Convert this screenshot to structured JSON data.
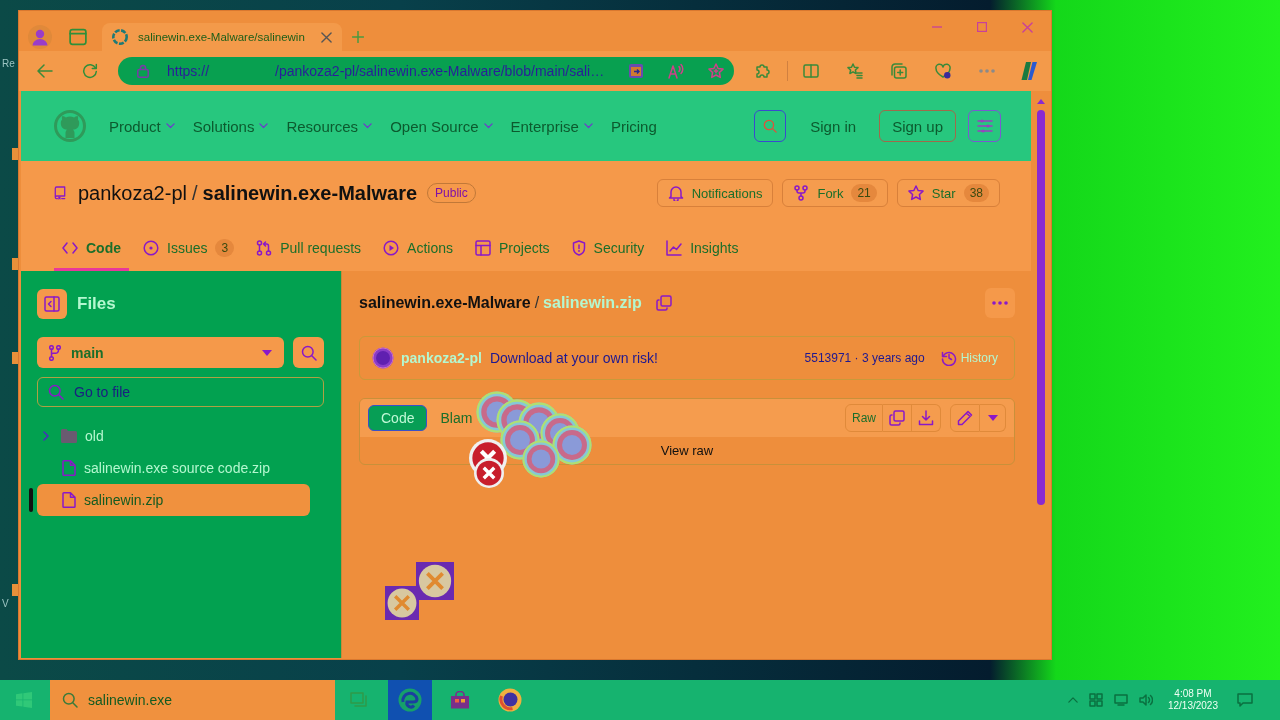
{
  "desktop": {
    "icon_labels": [
      "Re",
      "V"
    ]
  },
  "browser": {
    "tabs": [
      {
        "title": "salinewin.exe-Malware/salinewin",
        "selected": true
      }
    ],
    "address": {
      "scheme": "https://",
      "path": "/pankoza2-pl/salinewin.exe-Malware/blob/main/sali…"
    }
  },
  "site_header": {
    "nav": [
      {
        "label": "Product",
        "dropdown": true
      },
      {
        "label": "Solutions",
        "dropdown": true
      },
      {
        "label": "Resources",
        "dropdown": true
      },
      {
        "label": "Open Source",
        "dropdown": true
      },
      {
        "label": "Enterprise",
        "dropdown": true
      },
      {
        "label": "Pricing",
        "dropdown": false
      }
    ],
    "sign_in": "Sign in",
    "sign_up": "Sign up"
  },
  "repo": {
    "owner": "pankoza2-pl",
    "separator": "/",
    "name": "salinewin.exe-Malware",
    "visibility": "Public",
    "actions": [
      {
        "kind": "notifications",
        "label": "Notifications"
      },
      {
        "kind": "fork",
        "label": "Fork",
        "count": "21"
      },
      {
        "kind": "star",
        "label": "Star",
        "count": "38"
      }
    ],
    "tabs": [
      {
        "kind": "code",
        "label": "Code",
        "selected": true
      },
      {
        "kind": "issues",
        "label": "Issues",
        "count": "3",
        "selected": false
      },
      {
        "kind": "pulls",
        "label": "Pull requests",
        "selected": false
      },
      {
        "kind": "actions",
        "label": "Actions",
        "selected": false
      },
      {
        "kind": "projects",
        "label": "Projects",
        "selected": false
      },
      {
        "kind": "security",
        "label": "Security",
        "selected": false
      },
      {
        "kind": "insights",
        "label": "Insights",
        "selected": false
      }
    ]
  },
  "files_panel": {
    "title": "Files",
    "branch": "main",
    "search_placeholder": "Go to file",
    "tree": [
      {
        "kind": "folder",
        "name": "old",
        "expanded": false,
        "selected": false
      },
      {
        "kind": "file",
        "name": "salinewin.exe source code.zip",
        "selected": false
      },
      {
        "kind": "file",
        "name": "salinewin.zip",
        "selected": true
      }
    ]
  },
  "file": {
    "breadcrumb": {
      "repo": "salinewin.exe-Malware",
      "separator": "/",
      "name": "salinewin.zip"
    },
    "commit": {
      "author": "pankoza2-pl",
      "message": "Download at your own risk!",
      "meta": "5513971 · 3 years ago",
      "history": "History"
    },
    "view_modes": [
      {
        "label": "Code",
        "selected": true
      },
      {
        "label": "Blam",
        "selected": false
      }
    ],
    "raw": "Raw",
    "body": "View raw"
  },
  "error_icons": [
    {
      "kind": "ring"
    },
    {
      "kind": "ring"
    },
    {
      "kind": "ring"
    },
    {
      "kind": "ring"
    },
    {
      "kind": "ring"
    },
    {
      "kind": "ring"
    },
    {
      "kind": "ring"
    },
    {
      "kind": "cross"
    },
    {
      "kind": "cross"
    },
    {
      "kind": "tile"
    },
    {
      "kind": "tile"
    }
  ],
  "taskbar": {
    "search_value": "salinewin.exe",
    "apps": [
      {
        "kind": "task_view",
        "active": false
      },
      {
        "kind": "edge",
        "active": true
      },
      {
        "kind": "store",
        "active": false
      },
      {
        "kind": "globe",
        "active": false
      }
    ],
    "clock": {
      "time": "4:08 PM",
      "date": "12/13/2023"
    }
  }
}
